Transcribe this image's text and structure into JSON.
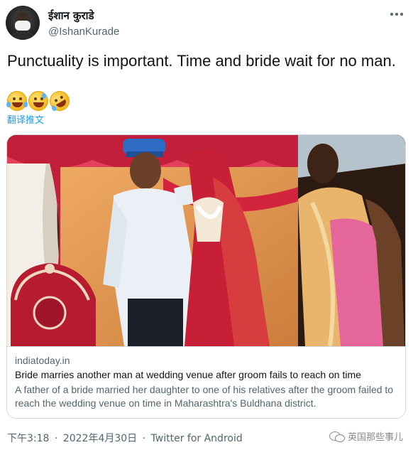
{
  "tweet": {
    "author": {
      "display_name": "ईशान कुराडे",
      "handle": "@IshanKurade",
      "avatar_icon": "user-avatar-masked"
    },
    "text": "Punctuality is important. Time and bride wait for no man.",
    "emojis": [
      "face-with-tears-of-joy",
      "grinning-face-with-sweat",
      "rolling-on-the-floor-laughing"
    ],
    "translate_label": "翻译推文",
    "more_icon": "more-options-icon"
  },
  "link_card": {
    "image_icon": "wedding-photo",
    "domain": "indiatoday.in",
    "title": "Bride marries another man at wedding venue after groom fails to reach on time",
    "description": "A father of a bride married her daughter to one of his relatives after the groom failed to reach the wedding venue on time in Maharashtra's Buldhana district."
  },
  "footer": {
    "time": "下午3:18",
    "date": "2022年4月30日",
    "source": "Twitter for Android",
    "separator": "·"
  },
  "watermark": {
    "text": "英国那些事儿",
    "icon": "wechat-icon"
  },
  "colors": {
    "link_blue": "#1d9bf0",
    "secondary_text": "#536471",
    "border": "#cfd9de"
  }
}
